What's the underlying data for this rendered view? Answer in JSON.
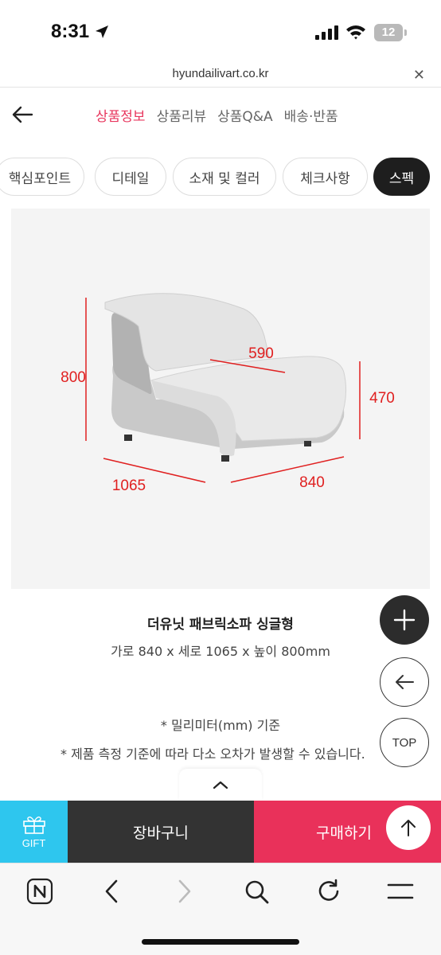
{
  "status_bar": {
    "time": "8:31",
    "battery": "12",
    "icons": [
      "location-arrow-icon",
      "signal-icon",
      "wifi-icon",
      "battery-icon"
    ]
  },
  "browser": {
    "url": "hyundailivart.co.kr",
    "close_icon": "close-icon"
  },
  "nav": {
    "tabs": [
      {
        "label": "상품정보",
        "active": true
      },
      {
        "label": "상품리뷰",
        "active": false
      },
      {
        "label": "상품Q&A",
        "active": false
      },
      {
        "label": "배송·반품",
        "active": false
      }
    ]
  },
  "chips": [
    {
      "label": "핵심포인트",
      "active": false
    },
    {
      "label": "디테일",
      "active": false
    },
    {
      "label": "소재 및 컬러",
      "active": false
    },
    {
      "label": "체크사항",
      "active": false
    },
    {
      "label": "스펙",
      "active": true
    }
  ],
  "dimensions": {
    "height": "800",
    "depth_seat": "590",
    "seat_height": "470",
    "length": "1065",
    "width": "840",
    "color": "#e02020"
  },
  "product": {
    "title": "더유닛 패브릭소파 싱글형",
    "size": "가로 840 x 세로 1065 x 높이 800mm",
    "note1": "* 밀리미터(mm) 기준",
    "note2": "* 제품 측정 기준에 따라 다소 오차가 발생할 수 있습니다."
  },
  "fab": {
    "top_label": "TOP"
  },
  "purchase": {
    "gift_label": "GIFT",
    "cart_label": "장바구니",
    "buy_label": "구매하기",
    "gift_color": "#2ec6ee",
    "buy_color": "#e9315a"
  }
}
